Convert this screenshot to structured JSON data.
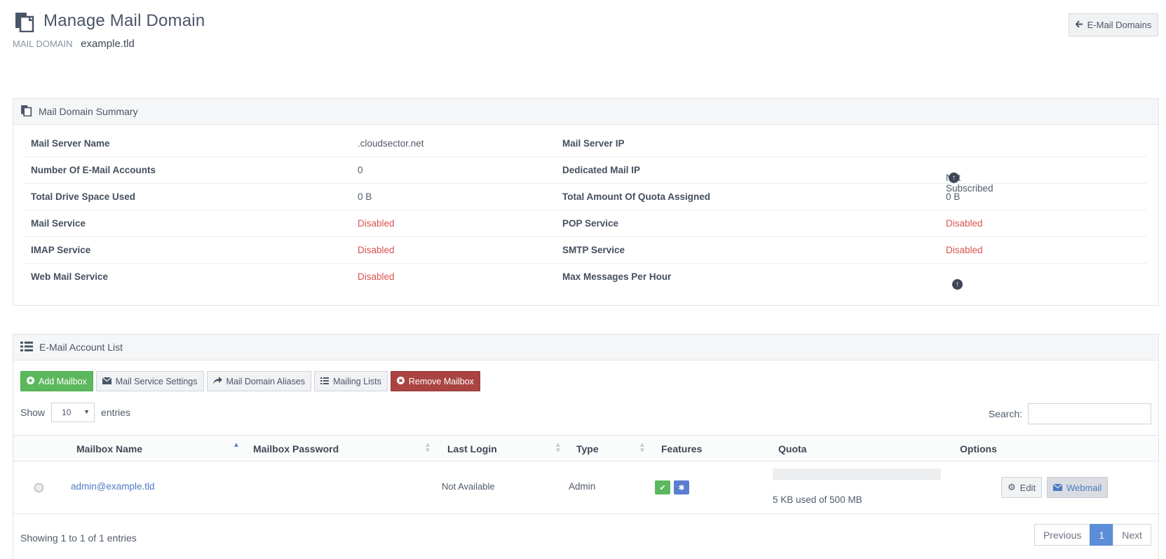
{
  "header": {
    "title": "Manage Mail Domain",
    "subtitle_label": "MAIL DOMAIN",
    "domain": "example.tld",
    "back_button": "E-Mail Domains"
  },
  "summary": {
    "title": "Mail Domain Summary",
    "rows": [
      {
        "label1": "Mail Server Name",
        "value1": ".cloudsector.net",
        "label2": "Mail Server IP",
        "value2": ""
      },
      {
        "label1": "Number Of E-Mail Accounts",
        "value1": "0",
        "label2": "Dedicated Mail IP",
        "value2": "Not Subscribed"
      },
      {
        "label1": "Total Drive Space Used",
        "value1": "0 B",
        "label2": "Total Amount Of Quota Assigned",
        "value2": "0 B"
      },
      {
        "label1": "Mail Service",
        "value1": "Disabled",
        "label2": "POP Service",
        "value2": "Disabled"
      },
      {
        "label1": "IMAP Service",
        "value1": "Disabled",
        "label2": "SMTP Service",
        "value2": "Disabled"
      },
      {
        "label1": "Web Mail Service",
        "value1": "Disabled",
        "label2": "Max Messages Per Hour",
        "value2": ""
      }
    ],
    "disabled_color": "#d9534f"
  },
  "list": {
    "title": "E-Mail Account List",
    "toolbar": {
      "add": "Add Mailbox",
      "settings": "Mail Service Settings",
      "aliases": "Mail Domain Aliases",
      "mailing": "Mailing Lists",
      "remove": "Remove Mailbox"
    },
    "show_label": "Show",
    "page_size": "10",
    "entries_label": "entries",
    "search_label": "Search:",
    "search_value": "",
    "columns": [
      "Mailbox Name",
      "Mailbox Password",
      "Last Login",
      "Type",
      "Features",
      "Quota",
      "Options"
    ],
    "rows": [
      {
        "mailbox": "admin@example.tld",
        "password": "",
        "last_login": "Not Available",
        "type": "Admin",
        "quota_text": "5 KB used of 500 MB",
        "quota_fraction": 1e-05,
        "edit": "Edit",
        "webmail": "Webmail"
      }
    ],
    "info": "Showing 1 to 1 of 1 entries",
    "pager": {
      "prev": "Previous",
      "page": "1",
      "next": "Next"
    }
  }
}
